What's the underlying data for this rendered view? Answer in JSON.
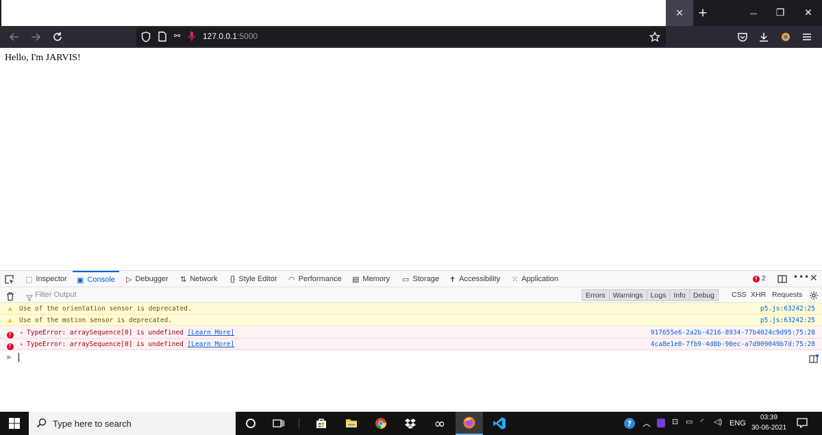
{
  "browser": {
    "url_host": "127.0.0.1",
    "url_port": ":5000",
    "icons": {
      "back": "arrow-left-icon",
      "forward": "arrow-right-icon",
      "reload": "reload-icon",
      "bookmark": "star-icon",
      "pocket": "pocket-icon",
      "downloads": "download-icon",
      "extensions": "extension-icon",
      "menu": "hamburger-menu-icon"
    },
    "tab_close": "×",
    "new_tab": "+",
    "window_minimize": "—",
    "window_restore": "❐",
    "window_close": "✕"
  },
  "page": {
    "text": "Hello, I'm JARVIS!"
  },
  "devtools": {
    "tabs": [
      {
        "label": "Inspector",
        "icon": "inspector-icon"
      },
      {
        "label": "Console",
        "icon": "console-icon",
        "active": true
      },
      {
        "label": "Debugger",
        "icon": "debugger-icon"
      },
      {
        "label": "Network",
        "icon": "network-icon"
      },
      {
        "label": "Style Editor",
        "icon": "braces-icon"
      },
      {
        "label": "Performance",
        "icon": "gauge-icon"
      },
      {
        "label": "Memory",
        "icon": "memory-icon"
      },
      {
        "label": "Storage",
        "icon": "storage-icon"
      },
      {
        "label": "Accessibility",
        "icon": "accessibility-icon"
      },
      {
        "label": "Application",
        "icon": "grid-icon"
      }
    ],
    "error_count": "2",
    "filter_placeholder": "Filter Output",
    "levels": [
      "Errors",
      "Warnings",
      "Logs",
      "Info",
      "Debug"
    ],
    "requests": [
      "CSS",
      "XHR",
      "Requests"
    ],
    "messages": [
      {
        "type": "warning",
        "text": "Use of the orientation sensor is deprecated.",
        "source": "p5.js:63242:25"
      },
      {
        "type": "warning",
        "text": "Use of the motion sensor is deprecated.",
        "source": "p5.js:63242:25"
      },
      {
        "type": "error",
        "text": "TypeError: arraySequence[0] is undefined",
        "link": "[Learn More]",
        "source": "917655e6-2a2b-4216-8934-77b4024c9d95:75:28"
      },
      {
        "type": "error",
        "text": "TypeError: arraySequence[0] is undefined",
        "link": "[Learn More]",
        "source": "4ca8e1e0-7fb9-4d8b-90ec-a7d909049b7d:75:28"
      }
    ],
    "colors": {
      "accent": "#0061e0",
      "warning_bg": "#fffbd6",
      "error_bg": "#fdf2f5",
      "error": "#d70022"
    }
  },
  "taskbar": {
    "search_placeholder": "Type here to search",
    "language": "ENG",
    "time": "03:39",
    "date": "30-06-2021"
  }
}
